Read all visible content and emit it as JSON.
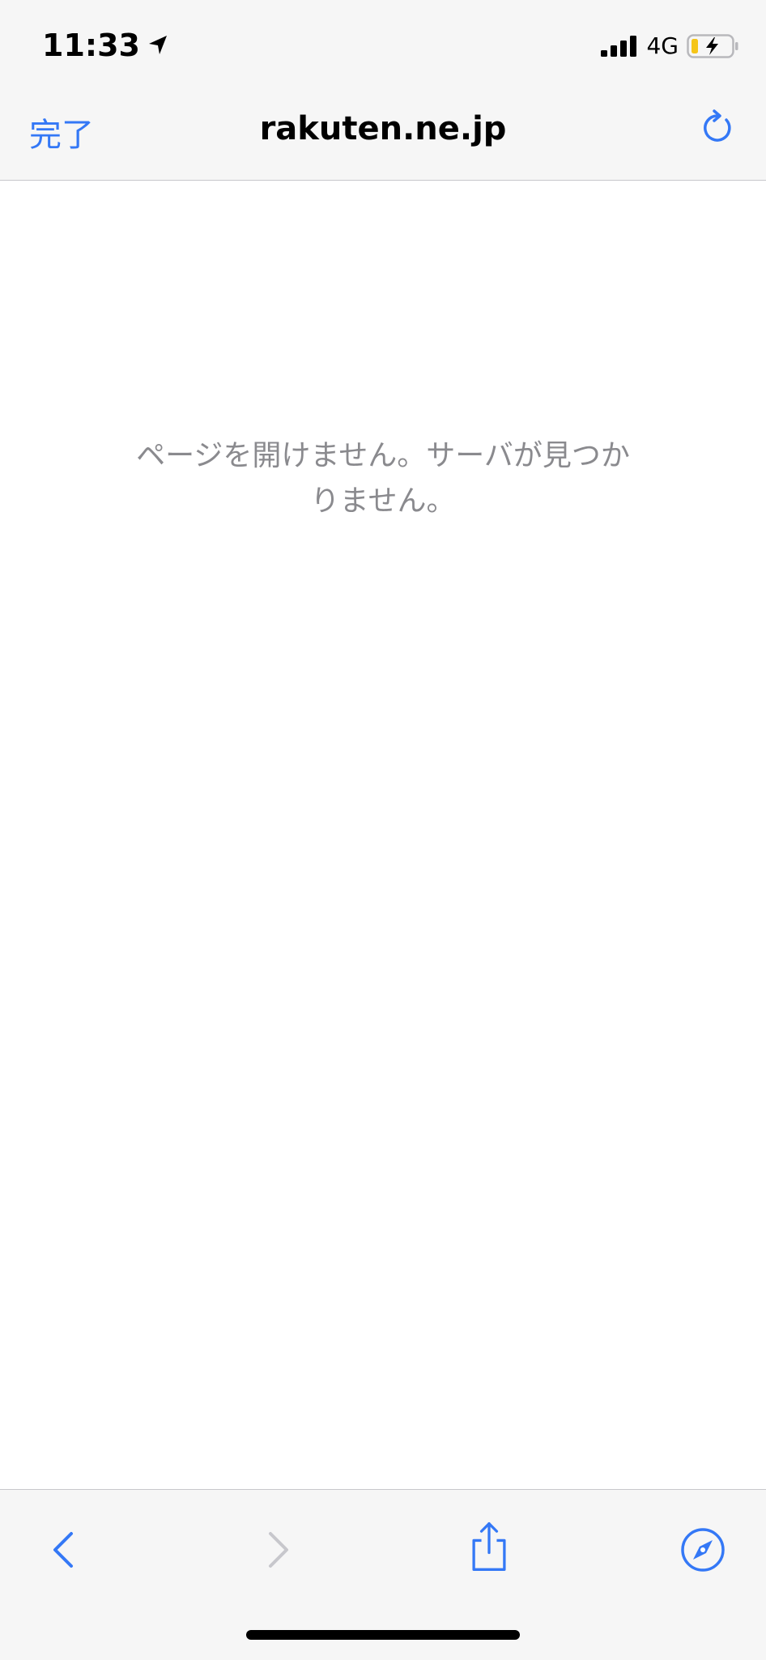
{
  "status_bar": {
    "time": "11:33",
    "network": "4G",
    "icons": [
      "location-arrow-icon",
      "signal-bars-icon",
      "battery-charging-icon"
    ]
  },
  "nav_bar": {
    "done_label": "完了",
    "title": "rakuten.ne.jp",
    "reload_icon": "reload-icon"
  },
  "content": {
    "error_line_1": "ページを開けません。サーバが見つか",
    "error_line_2": "りません。"
  },
  "toolbar": {
    "icons": [
      "back-icon",
      "forward-icon",
      "share-icon",
      "safari-compass-icon"
    ]
  },
  "colors": {
    "accent": "#3478f6",
    "disabled": "#c7c7cc",
    "bar_background": "#f6f6f6",
    "error_text": "#8a8a8e",
    "battery_level": "#f5c518"
  }
}
